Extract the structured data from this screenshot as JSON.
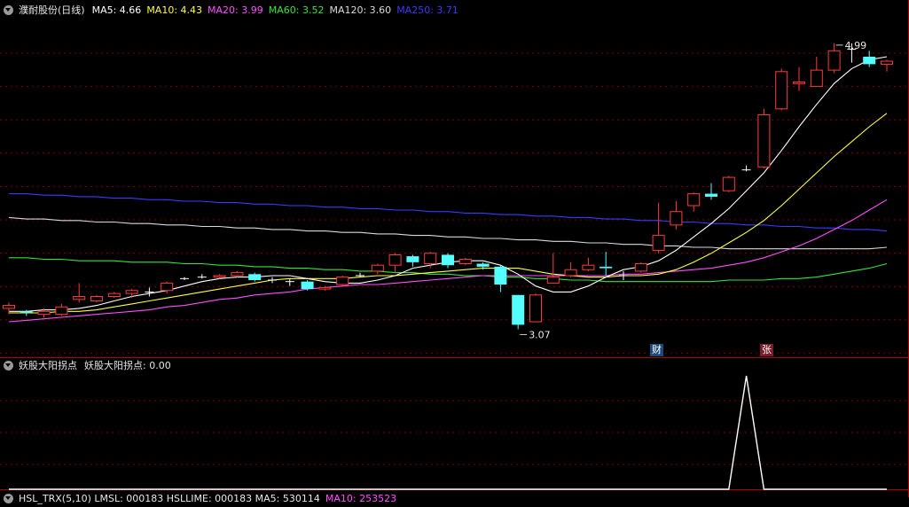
{
  "main_legend": {
    "title": "濮耐股份(日线)",
    "items": [
      {
        "label": "MA5: 4.66",
        "color": "#ffffff"
      },
      {
        "label": "MA10: 4.43",
        "color": "#ffff3a"
      },
      {
        "label": "MA20: 3.99",
        "color": "#ff4dff"
      },
      {
        "label": "MA60: 3.52",
        "color": "#33e633"
      },
      {
        "label": "MA120: 3.60",
        "color": "#d9d9d9"
      },
      {
        "label": "MA250: 3.71",
        "color": "#3a3aff"
      }
    ]
  },
  "indicator_legend": {
    "title": "妖股大阳拐点",
    "items": [
      {
        "label": "妖股大阳拐点: 0.00",
        "color": "#e6e6e6"
      }
    ]
  },
  "bottom_legend": {
    "title": "",
    "items": [
      {
        "label": "HSL_TRX(5,10) LMSL: 000183 HSLLIME: 000183 MA5: 530114",
        "color": "#e6e6e6"
      },
      {
        "label": "MA10: 253523",
        "color": "#ff4dff"
      }
    ]
  },
  "markers": {
    "cai": {
      "text": "财",
      "bg": "#1d4a7a"
    },
    "zhang": {
      "text": "张",
      "bg": "#7a1d2a"
    }
  },
  "chart_data": [
    {
      "type": "candlestick",
      "ylim": [
        2.9,
        5.15
      ],
      "grid": true,
      "annotations": [
        {
          "text": "4.99",
          "index": 47,
          "value": 4.99
        },
        {
          "text": "3.07",
          "index": 29,
          "value": 3.07
        }
      ],
      "colors": {
        "up": "#ff3b3b",
        "down": "#54ffff",
        "flat": "#ffffff"
      },
      "candles": [
        [
          3.21,
          3.23,
          3.17,
          3.25
        ],
        [
          3.19,
          3.18,
          3.16,
          3.2
        ],
        [
          3.17,
          3.19,
          3.15,
          3.21
        ],
        [
          3.17,
          3.22,
          3.16,
          3.24
        ],
        [
          3.27,
          3.29,
          3.25,
          3.38
        ],
        [
          3.26,
          3.29,
          3.25,
          3.3
        ],
        [
          3.29,
          3.31,
          3.28,
          3.32
        ],
        [
          3.31,
          3.33,
          3.28,
          3.34
        ],
        [
          3.32,
          3.32,
          3.29,
          3.35
        ],
        [
          3.33,
          3.38,
          3.31,
          3.39
        ],
        [
          3.41,
          3.41,
          3.4,
          3.42
        ],
        [
          3.42,
          3.42,
          3.41,
          3.44
        ],
        [
          3.42,
          3.43,
          3.41,
          3.44
        ],
        [
          3.43,
          3.45,
          3.42,
          3.46
        ],
        [
          3.44,
          3.4,
          3.39,
          3.45
        ],
        [
          3.4,
          3.4,
          3.38,
          3.42
        ],
        [
          3.39,
          3.39,
          3.36,
          3.41
        ],
        [
          3.39,
          3.34,
          3.33,
          3.4
        ],
        [
          3.34,
          3.35,
          3.33,
          3.36
        ],
        [
          3.37,
          3.42,
          3.36,
          3.43
        ],
        [
          3.43,
          3.43,
          3.42,
          3.45
        ],
        [
          3.46,
          3.5,
          3.44,
          3.51
        ],
        [
          3.5,
          3.57,
          3.45,
          3.58
        ],
        [
          3.56,
          3.52,
          3.49,
          3.57
        ],
        [
          3.51,
          3.58,
          3.48,
          3.59
        ],
        [
          3.57,
          3.5,
          3.48,
          3.58
        ],
        [
          3.51,
          3.54,
          3.5,
          3.55
        ],
        [
          3.51,
          3.49,
          3.47,
          3.52
        ],
        [
          3.49,
          3.37,
          3.32,
          3.5
        ],
        [
          3.3,
          3.1,
          3.07,
          3.3
        ],
        [
          3.12,
          3.3,
          3.12,
          3.31
        ],
        [
          3.38,
          3.42,
          3.4,
          3.58
        ],
        [
          3.43,
          3.47,
          3.42,
          3.52
        ],
        [
          3.47,
          3.5,
          3.46,
          3.55
        ],
        [
          3.49,
          3.48,
          3.43,
          3.59
        ],
        [
          3.43,
          3.43,
          3.4,
          3.46
        ],
        [
          3.46,
          3.51,
          3.45,
          3.52
        ],
        [
          3.6,
          3.7,
          3.58,
          3.92
        ],
        [
          3.77,
          3.86,
          3.74,
          3.93
        ],
        [
          3.9,
          3.98,
          3.86,
          3.99
        ],
        [
          3.98,
          3.96,
          3.94,
          4.05
        ],
        [
          4.0,
          4.09,
          3.99,
          4.1
        ],
        [
          4.14,
          4.14,
          4.13,
          4.17
        ],
        [
          4.16,
          4.51,
          4.15,
          4.55
        ],
        [
          4.55,
          4.8,
          4.54,
          4.82
        ],
        [
          4.72,
          4.73,
          4.67,
          4.83
        ],
        [
          4.7,
          4.81,
          4.7,
          4.9
        ],
        [
          4.81,
          4.94,
          4.79,
          4.99
        ],
        [
          4.95,
          4.95,
          4.86,
          4.99
        ],
        [
          4.9,
          4.85,
          4.83,
          4.94
        ],
        [
          4.85,
          4.87,
          4.8,
          4.88
        ]
      ],
      "ma": [
        {
          "name": "MA5",
          "color": "#ffffff",
          "values": [
            3.19,
            3.19,
            3.2,
            3.2,
            3.21,
            3.23,
            3.26,
            3.29,
            3.31,
            3.33,
            3.36,
            3.39,
            3.41,
            3.42,
            3.42,
            3.43,
            3.43,
            3.41,
            3.39,
            3.38,
            3.38,
            3.4,
            3.43,
            3.48,
            3.5,
            3.52,
            3.53,
            3.53,
            3.5,
            3.44,
            3.36,
            3.32,
            3.32,
            3.36,
            3.42,
            3.47,
            3.49,
            3.53,
            3.6,
            3.69,
            3.78,
            3.88,
            4.0,
            4.12,
            4.27,
            4.43,
            4.58,
            4.72,
            4.82,
            4.88,
            4.9
          ]
        },
        {
          "name": "MA10",
          "color": "#ffff3a",
          "values": [
            3.18,
            3.18,
            3.18,
            3.19,
            3.19,
            3.2,
            3.22,
            3.24,
            3.26,
            3.28,
            3.3,
            3.32,
            3.34,
            3.36,
            3.38,
            3.4,
            3.41,
            3.41,
            3.41,
            3.41,
            3.42,
            3.43,
            3.43,
            3.44,
            3.45,
            3.46,
            3.47,
            3.48,
            3.48,
            3.48,
            3.46,
            3.44,
            3.43,
            3.42,
            3.42,
            3.43,
            3.43,
            3.44,
            3.47,
            3.52,
            3.58,
            3.65,
            3.72,
            3.8,
            3.9,
            4.01,
            4.12,
            4.23,
            4.33,
            4.43,
            4.52
          ]
        },
        {
          "name": "MA20",
          "color": "#ff4dff",
          "values": [
            3.12,
            3.13,
            3.14,
            3.15,
            3.16,
            3.17,
            3.18,
            3.19,
            3.2,
            3.22,
            3.23,
            3.25,
            3.27,
            3.28,
            3.3,
            3.31,
            3.32,
            3.34,
            3.35,
            3.36,
            3.37,
            3.37,
            3.38,
            3.39,
            3.4,
            3.41,
            3.42,
            3.43,
            3.43,
            3.43,
            3.43,
            3.43,
            3.43,
            3.43,
            3.43,
            3.44,
            3.44,
            3.45,
            3.46,
            3.47,
            3.48,
            3.5,
            3.52,
            3.55,
            3.59,
            3.63,
            3.68,
            3.74,
            3.8,
            3.87,
            3.94
          ]
        },
        {
          "name": "MA60",
          "color": "#33e633",
          "values": [
            3.55,
            3.55,
            3.54,
            3.54,
            3.53,
            3.53,
            3.53,
            3.52,
            3.52,
            3.52,
            3.51,
            3.51,
            3.5,
            3.5,
            3.49,
            3.49,
            3.48,
            3.48,
            3.47,
            3.47,
            3.46,
            3.46,
            3.45,
            3.45,
            3.44,
            3.44,
            3.43,
            3.43,
            3.42,
            3.42,
            3.41,
            3.41,
            3.4,
            3.4,
            3.39,
            3.39,
            3.39,
            3.39,
            3.39,
            3.39,
            3.39,
            3.4,
            3.4,
            3.4,
            3.41,
            3.41,
            3.42,
            3.44,
            3.46,
            3.48,
            3.51
          ]
        },
        {
          "name": "MA120",
          "color": "#d9d9d9",
          "values": [
            3.82,
            3.81,
            3.81,
            3.8,
            3.8,
            3.79,
            3.79,
            3.78,
            3.78,
            3.77,
            3.77,
            3.76,
            3.76,
            3.75,
            3.75,
            3.74,
            3.74,
            3.73,
            3.73,
            3.72,
            3.72,
            3.71,
            3.71,
            3.7,
            3.7,
            3.69,
            3.69,
            3.68,
            3.68,
            3.67,
            3.67,
            3.66,
            3.66,
            3.65,
            3.65,
            3.64,
            3.64,
            3.63,
            3.63,
            3.62,
            3.62,
            3.61,
            3.61,
            3.61,
            3.61,
            3.61,
            3.61,
            3.61,
            3.61,
            3.61,
            3.62
          ]
        },
        {
          "name": "MA250",
          "color": "#3a3aff",
          "values": [
            3.98,
            3.98,
            3.97,
            3.97,
            3.96,
            3.96,
            3.95,
            3.95,
            3.94,
            3.94,
            3.93,
            3.93,
            3.92,
            3.92,
            3.91,
            3.91,
            3.9,
            3.9,
            3.89,
            3.89,
            3.88,
            3.88,
            3.87,
            3.87,
            3.86,
            3.86,
            3.85,
            3.85,
            3.84,
            3.84,
            3.83,
            3.83,
            3.82,
            3.82,
            3.81,
            3.81,
            3.8,
            3.8,
            3.79,
            3.79,
            3.78,
            3.78,
            3.77,
            3.77,
            3.76,
            3.76,
            3.75,
            3.75,
            3.74,
            3.74,
            3.73
          ]
        }
      ]
    },
    {
      "type": "line",
      "ylim": [
        0,
        1
      ],
      "series": [
        {
          "name": "妖股大阳拐点",
          "color": "#ffffff",
          "values": [
            0,
            0,
            0,
            0,
            0,
            0,
            0,
            0,
            0,
            0,
            0,
            0,
            0,
            0,
            0,
            0,
            0,
            0,
            0,
            0,
            0,
            0,
            0,
            0,
            0,
            0,
            0,
            0,
            0,
            0,
            0,
            0,
            0,
            0,
            0,
            0,
            0,
            0,
            0,
            0,
            0,
            0,
            1,
            0,
            0,
            0,
            0,
            0,
            0,
            0,
            0
          ]
        }
      ]
    }
  ]
}
